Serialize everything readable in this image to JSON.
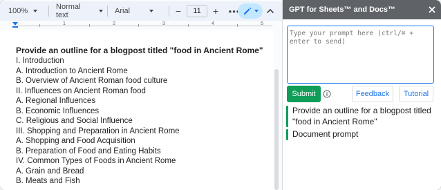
{
  "toolbar": {
    "zoom": "100%",
    "style": "Normal text",
    "font": "Arial",
    "minus": "−",
    "font_size": "11",
    "plus": "+",
    "more": "•••"
  },
  "ruler": {
    "numbers": [
      "1",
      "2",
      "3",
      "4",
      "5"
    ]
  },
  "document": {
    "title": "Provide an outline for a blogpost titled \"food in Ancient Rome\"",
    "lines": [
      "I. Introduction",
      "A. Introduction to Ancient Rome",
      "B. Overview of Ancient Roman food culture",
      "II. Influences on Ancient Roman food",
      "A. Regional Influences",
      "B. Economic Influences",
      "C. Religious and Social Influence",
      "III. Shopping and Preparation in Ancient Rome",
      "A. Shopping and Food Acquisition",
      "B. Preparation of Food and Eating Habits",
      "IV. Common Types of Foods in Ancient Rome",
      "A. Grain and Bread",
      "B. Meats and Fish"
    ]
  },
  "panel": {
    "title": "GPT for Sheets™ and Docs™",
    "prompt_placeholder": "Type your prompt here (ctrl/⌘ + enter to send)",
    "submit_label": "Submit",
    "feedback_label": "Feedback",
    "tutorial_label": "Tutorial",
    "history": [
      "Provide an outline for a blogpost titled \"food in Ancient Rome\"",
      "Document prompt"
    ]
  },
  "colors": {
    "accent_blue": "#1a73e8",
    "submit_green": "#0f9d58",
    "header_gray": "#5f6368"
  }
}
